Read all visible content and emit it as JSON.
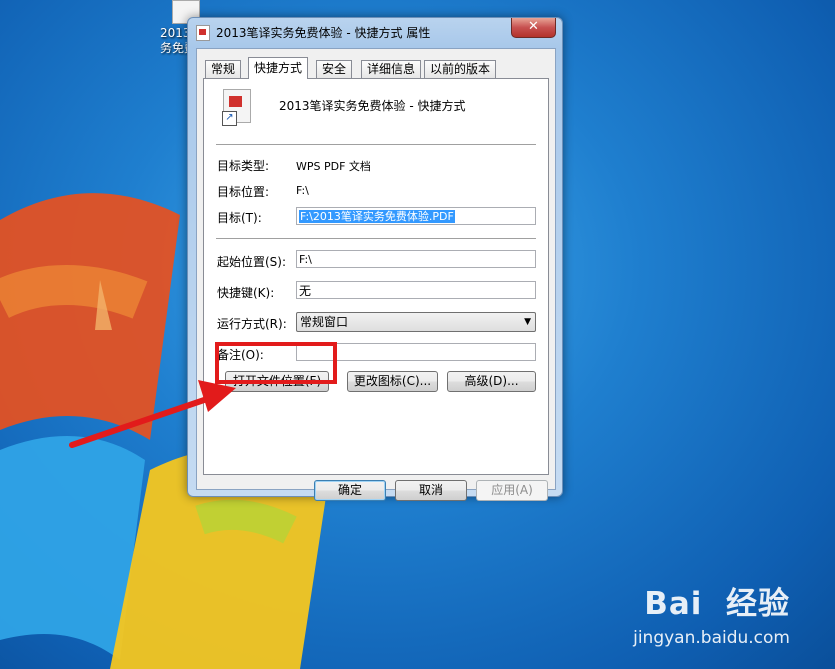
{
  "desktop": {
    "icon_label": "2013\n务免费"
  },
  "window": {
    "title": "2013笔译实务免费体验 - 快捷方式 属性",
    "close_glyph": "✕"
  },
  "tabs": [
    {
      "label": "常规"
    },
    {
      "label": "快捷方式"
    },
    {
      "label": "安全"
    },
    {
      "label": "详细信息"
    },
    {
      "label": "以前的版本"
    }
  ],
  "shortcut": {
    "name": "2013笔译实务免费体验 - 快捷方式",
    "target_type_label": "目标类型:",
    "target_type_value": "WPS PDF 文档",
    "target_location_label": "目标位置:",
    "target_location_value": "F:\\",
    "target_label": "目标(T):",
    "target_value": "F:\\2013笔译实务免费体验.PDF",
    "start_in_label": "起始位置(S):",
    "start_in_value": "F:\\",
    "hotkey_label": "快捷键(K):",
    "hotkey_value": "无",
    "run_label": "运行方式(R):",
    "run_value": "常规窗口",
    "comment_label": "备注(O):",
    "comment_value": ""
  },
  "buttons": {
    "open_location": "打开文件位置(F)",
    "change_icon": "更改图标(C)...",
    "advanced": "高级(D)...",
    "ok": "确定",
    "cancel": "取消",
    "apply": "应用(A)"
  },
  "watermark": {
    "brand": "Bai  经验",
    "url": "jingyan.baidu.com"
  },
  "colors": {
    "highlight": "#e21b1b",
    "selection": "#3399ff"
  }
}
